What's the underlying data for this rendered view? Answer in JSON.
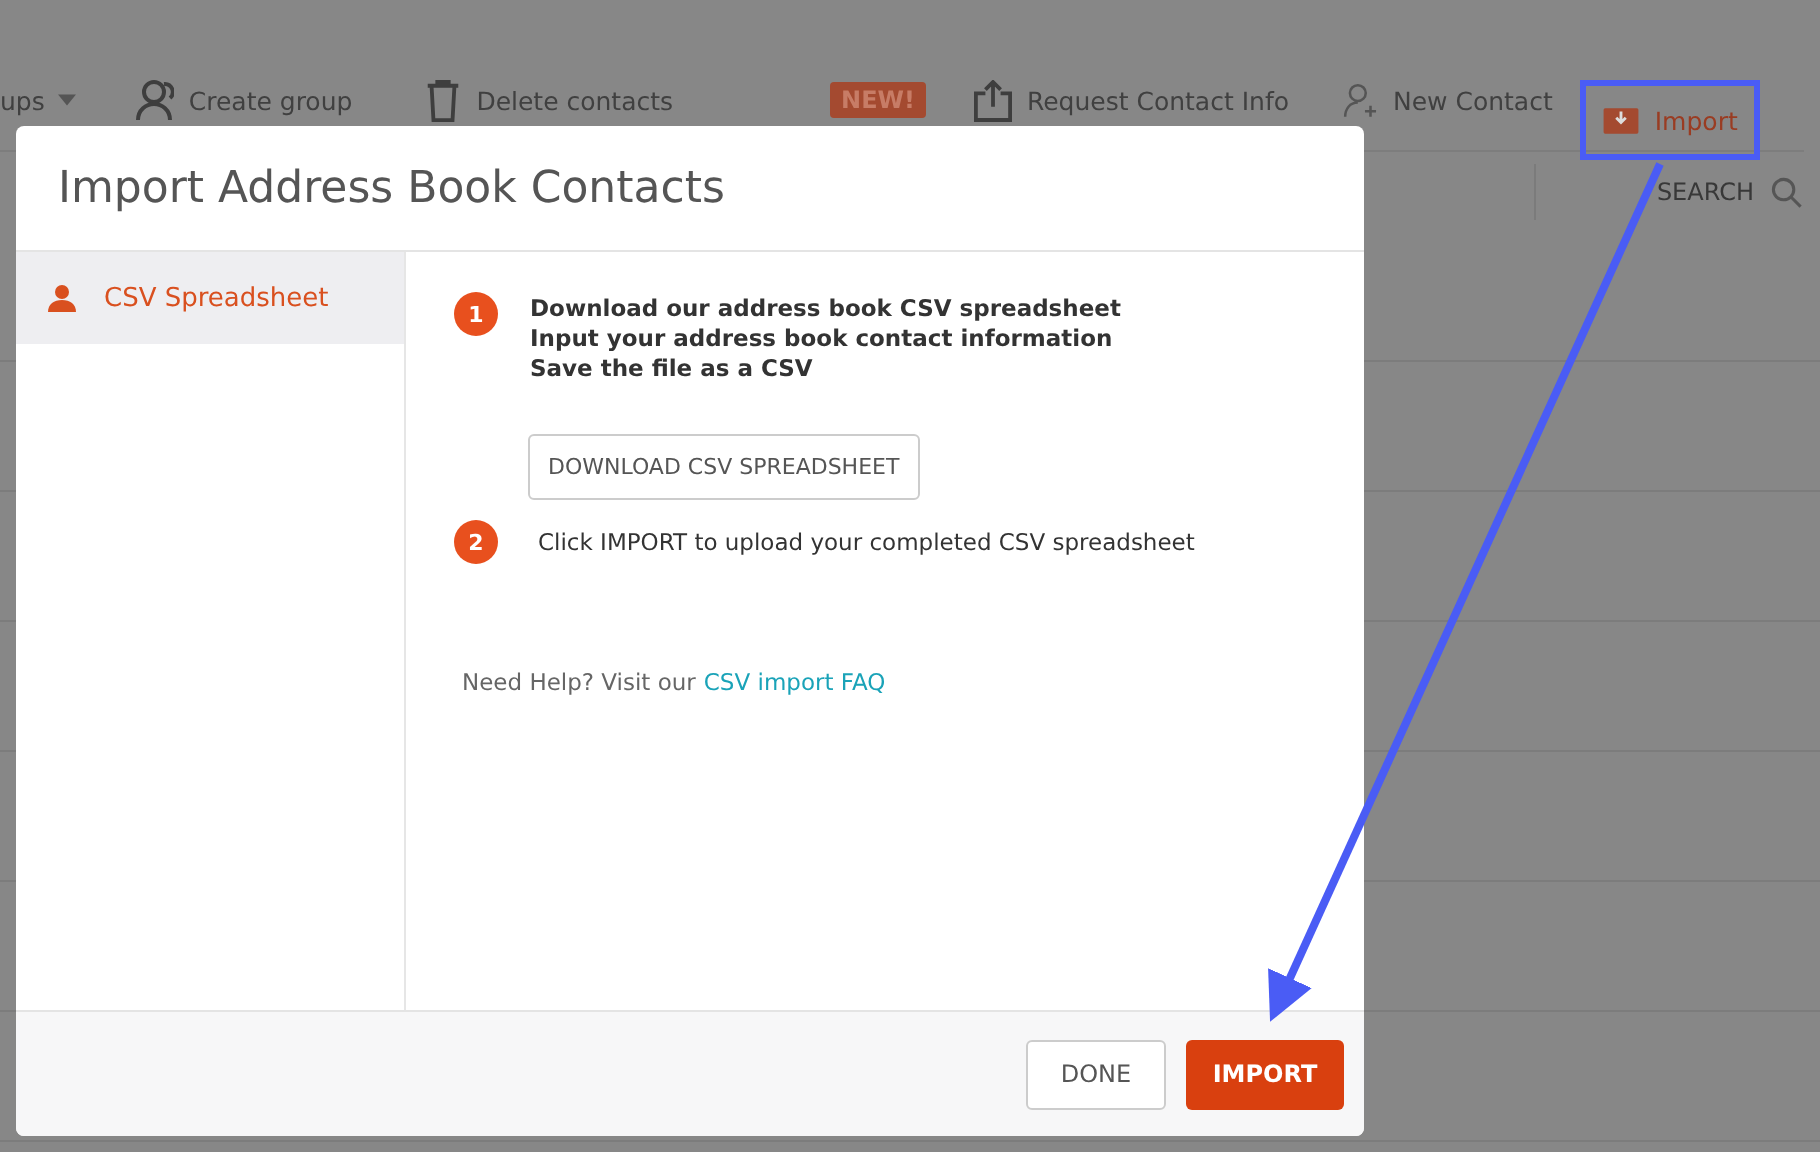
{
  "toolbar": {
    "items": [
      {
        "label": "ups",
        "kind": "dropdown",
        "highlighted": false
      },
      {
        "label": "Create group",
        "kind": "group",
        "highlighted": false
      },
      {
        "label": "Delete contacts",
        "kind": "delete",
        "highlighted": false
      },
      {
        "label": "Request Contact Info",
        "kind": "request",
        "badge": "NEW!",
        "highlighted": false
      },
      {
        "label": "New Contact",
        "kind": "contact",
        "highlighted": false
      },
      {
        "label": "Import",
        "kind": "import",
        "highlighted": true
      }
    ]
  },
  "search": {
    "label": "SEARCH"
  },
  "dialog": {
    "title": "Import Address Book Contacts",
    "sidebar": [
      {
        "label": "CSV Spreadsheet",
        "selected": true
      }
    ],
    "steps": [
      {
        "number": "1",
        "emphasis": true,
        "lines": [
          "Download our address book CSV spreadsheet",
          "Input your address book contact information",
          "Save the file as a CSV"
        ],
        "button": "DOWNLOAD CSV SPREADSHEET"
      },
      {
        "number": "2",
        "emphasis": false,
        "lines": [
          "Click IMPORT to upload your completed CSV spreadsheet"
        ]
      }
    ],
    "help": {
      "text": "Need Help? Visit our",
      "link": "CSV import FAQ"
    },
    "buttons": [
      {
        "label": "DONE",
        "kind": "secondary"
      },
      {
        "label": "IMPORT",
        "kind": "primary"
      }
    ]
  }
}
